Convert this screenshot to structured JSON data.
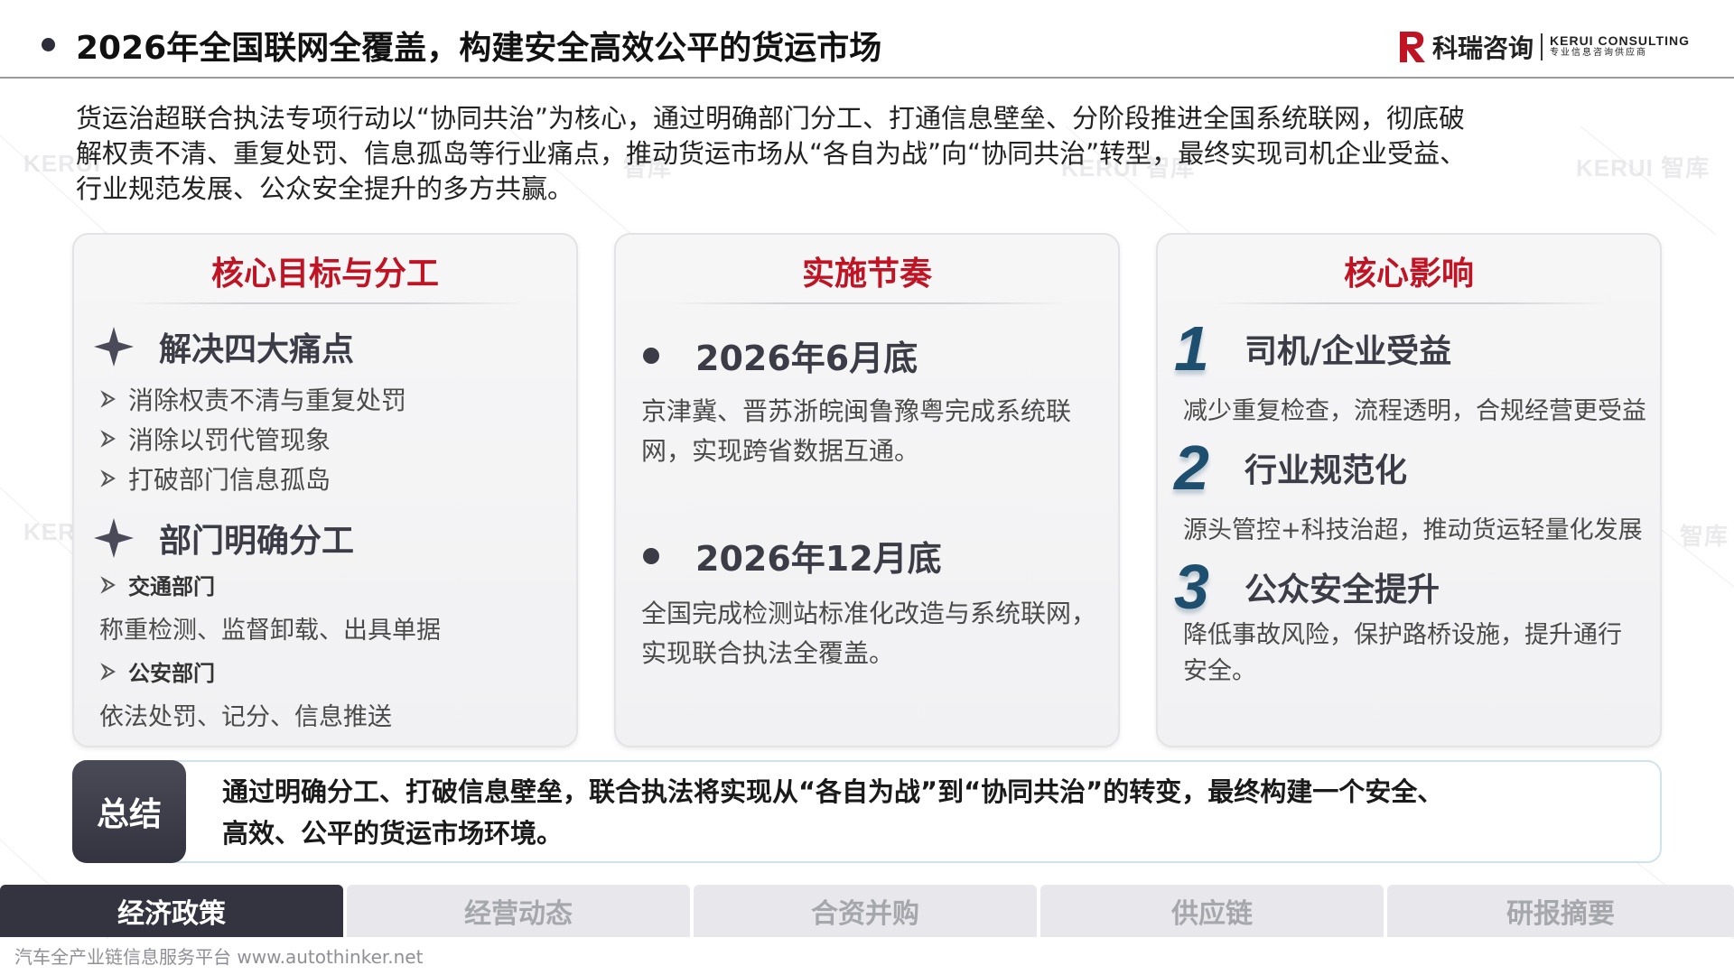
{
  "header": {
    "title": "2026年全国联网全覆盖，构建安全高效公平的货运市场",
    "logo_cn": "科瑞咨询",
    "logo_en_line1": "KERUI CONSULTING",
    "logo_en_line2": "专业信息咨询供应商"
  },
  "watermark": {
    "text_en": "KERUI",
    "text_cn": "智库"
  },
  "intro": {
    "lines": [
      "货运治超联合执法专项行动以“协同共治”为核心，通过明确部门分工、打通信息壁垒、分阶段推进全国系统联网，彻底破",
      "解权责不清、重复处罚、信息孤岛等行业痛点，推动货运市场从“各自为战”向“协同共治”转型，最终实现司机企业受益、",
      "行业规范发展、公众安全提升的多方共赢。"
    ]
  },
  "cards": {
    "goals": {
      "title": "核心目标与分工",
      "section1_title": "解决四大痛点",
      "section1_items": [
        "消除权责不清与重复处罚",
        "消除以罚代管现象",
        "打破部门信息孤岛"
      ],
      "section2_title": "部门明确分工",
      "sub1_title": "交通部门",
      "sub1_text": "称重检测、监督卸载、出具单据",
      "sub2_title": "公安部门",
      "sub2_text": "依法处罚、记分、信息推送"
    },
    "timeline": {
      "title": "实施节奏",
      "items": [
        {
          "date": "2026年6月底",
          "line1": "京津冀、晋苏浙皖闽鲁豫粤完成系统联",
          "line2": "网，实现跨省数据互通。"
        },
        {
          "date": "2026年12月底",
          "line1": "全国完成检测站标准化改造与系统联网，",
          "line2": "实现联合执法全覆盖。"
        }
      ]
    },
    "impact": {
      "title": "核心影响",
      "items": [
        {
          "num": "1",
          "title": "司机/企业受益",
          "line1": "减少重复检查，流程透明，合规经营更受益",
          "line2": ""
        },
        {
          "num": "2",
          "title": "行业规范化",
          "line1": "源头管控+科技治超，推动货运轻量化发展",
          "line2": ""
        },
        {
          "num": "3",
          "title": "公众安全提升",
          "line1": "降低事故风险，保护路桥设施，提升通行",
          "line2": "安全。"
        }
      ]
    }
  },
  "summary": {
    "label": "总结",
    "line1": "通过明确分工、打破信息壁垒，联合执法将实现从“各自为战”到“协同共治”的转变，最终构建一个安全、",
    "line2": "高效、公平的货运市场环境。"
  },
  "nav": {
    "tabs": [
      "经济政策",
      "经营动态",
      "合资并购",
      "供应链",
      "研报摘要"
    ],
    "active_index": 0
  },
  "footer": {
    "text": "汽车全产业链信息服务平台 www.autothinker.net"
  },
  "colors": {
    "accent_red": "#c01425",
    "dark": "#343440",
    "number_blue": "#1f4f6e"
  }
}
